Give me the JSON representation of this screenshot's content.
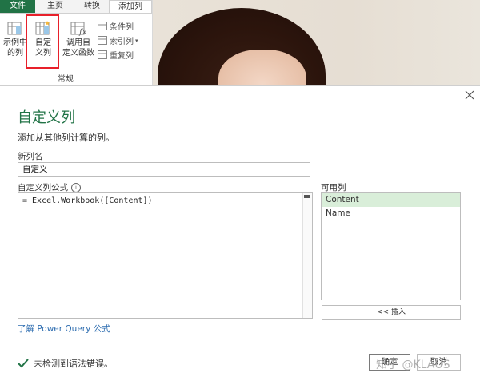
{
  "ribbon": {
    "tabs": [
      "文件",
      "主页",
      "转换",
      "添加列"
    ],
    "buttons": {
      "example_col": [
        "示例中",
        "的列"
      ],
      "custom_col": [
        "自定",
        "义列"
      ],
      "invoke_fn": [
        "调用自",
        "定义函数"
      ]
    },
    "small_items": [
      "条件列",
      "索引列",
      "重复列"
    ],
    "group_label": "常规"
  },
  "dialog": {
    "title": "自定义列",
    "description": "添加从其他列计算的列。",
    "new_col_label": "新列名",
    "new_col_value": "自定义",
    "formula_label": "自定义列公式",
    "formula": "= Excel.Workbook([Content])",
    "available_label": "可用列",
    "available_columns": [
      "Content",
      "Name"
    ],
    "insert_button": "<< 插入",
    "learn_link": "了解 Power Query 公式",
    "status": "未检测到语法错误。",
    "ok": "确定",
    "cancel": "取消"
  },
  "watermark": "知乎 @KLAUS",
  "colors": {
    "accent": "#217346",
    "highlight": "#e8202a",
    "link": "#2e6db0",
    "selected_row": "#d9eed9"
  },
  "icons": [
    "custom-column-icon",
    "example-column-icon",
    "invoke-function-icon",
    "close-icon",
    "check-icon",
    "info-icon"
  ]
}
